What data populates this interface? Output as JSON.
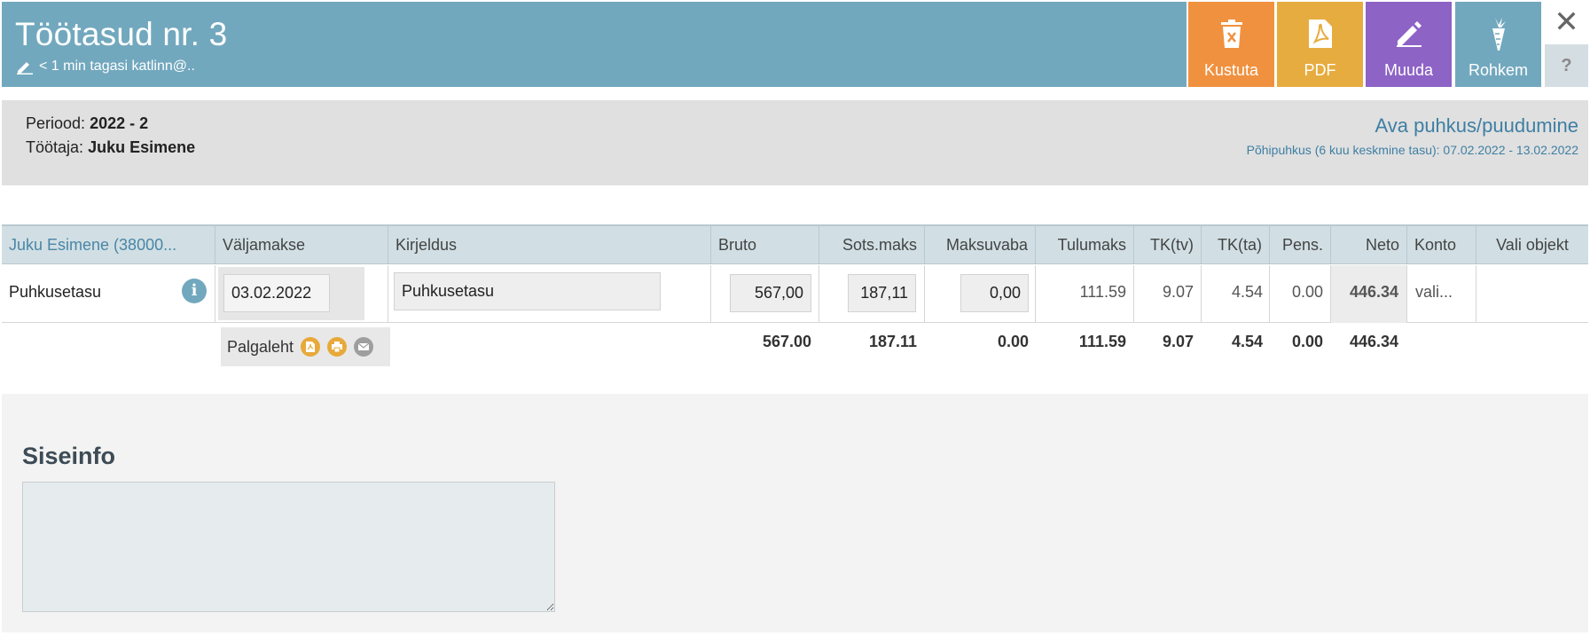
{
  "header": {
    "title": "Töötasud nr. 3",
    "subtitle": "< 1 min tagasi katlinn@.."
  },
  "toolbar": {
    "delete_label": "Kustuta",
    "pdf_label": "PDF",
    "edit_label": "Muuda",
    "more_label": "Rohkem",
    "close_symbol": "✕",
    "help_symbol": "?"
  },
  "info": {
    "period_label": "Periood:",
    "period_value": "2022 - 2",
    "employee_label": "Töötaja:",
    "employee_value": "Juku Esimene",
    "leave_link": "Ava puhkus/puudumine",
    "leave_detail": "Põhipuhkus (6 kuu keskmine tasu): 07.02.2022 - 13.02.2022"
  },
  "table": {
    "headers": {
      "employee": "Juku Esimene (38000...",
      "payout": "Väljamakse",
      "description": "Kirjeldus",
      "gross": "Bruto",
      "social_tax": "Sots.maks",
      "tax_free": "Maksuvaba",
      "income_tax": "Tulumaks",
      "tk_tv": "TK(tv)",
      "tk_ta": "TK(ta)",
      "pension": "Pens.",
      "net": "Neto",
      "account": "Konto",
      "object": "Vali objekt"
    },
    "row": {
      "label": "Puhkusetasu",
      "info_symbol": "i",
      "date": "03.02.2022",
      "description": "Puhkusetasu",
      "gross": "567,00",
      "social_tax": "187,11",
      "tax_free": "0,00",
      "income_tax": "111.59",
      "tk_tv": "9.07",
      "tk_ta": "4.54",
      "pension": "0.00",
      "net": "446.34",
      "account": "vali..."
    },
    "totals": {
      "payslip_label": "Palgaleht",
      "gross": "567.00",
      "social_tax": "187.11",
      "tax_free": "0.00",
      "income_tax": "111.59",
      "tk_tv": "9.07",
      "tk_ta": "4.54",
      "pension": "0.00",
      "net": "446.34"
    }
  },
  "siseinfo": {
    "title": "Siseinfo",
    "value": ""
  },
  "colors": {
    "header_bg": "#72a8be",
    "delete": "#f0913f",
    "pdf": "#e7ac3f",
    "edit": "#8d63c6",
    "more": "#72a8be",
    "link": "#3e7fa3"
  },
  "icons": {
    "subtitle": "pencil-icon",
    "delete": "trash-icon",
    "pdf": "pdf-file-icon",
    "edit": "pencil-icon",
    "more": "carrot-icon",
    "payslip": [
      "pdf-icon",
      "print-icon",
      "email-icon"
    ]
  }
}
